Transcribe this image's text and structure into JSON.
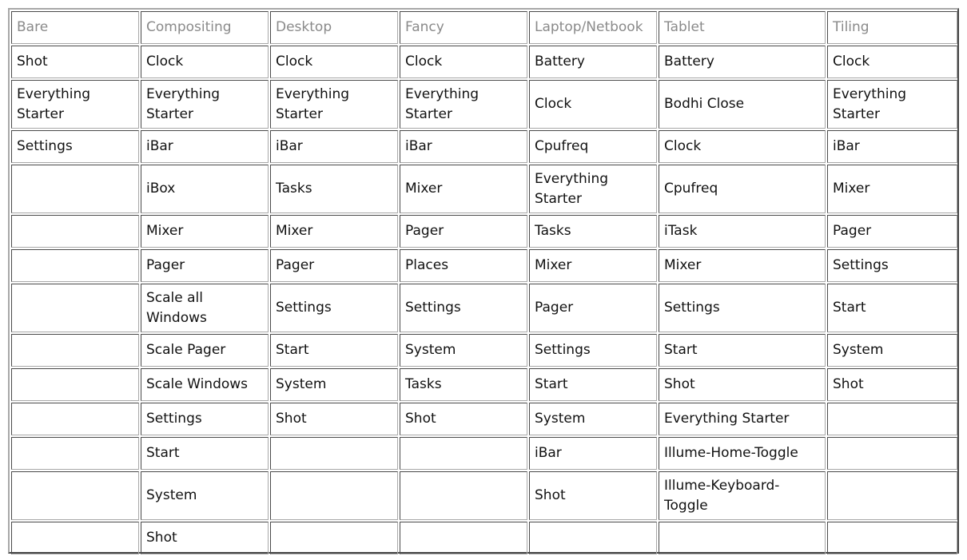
{
  "table": {
    "headers": [
      "Bare",
      "Compositing",
      "Desktop",
      "Fancy",
      "Laptop/Netbook",
      "Tablet",
      "Tiling"
    ],
    "rows": [
      [
        "Shot",
        "Clock",
        "Clock",
        "Clock",
        "Battery",
        "Battery",
        "Clock"
      ],
      [
        "Everything Starter",
        "Everything Starter",
        "Everything Starter",
        "Everything Starter",
        "Clock",
        "Bodhi Close",
        "Everything Starter"
      ],
      [
        "Settings",
        "iBar",
        "iBar",
        "iBar",
        "Cpufreq",
        "Clock",
        "iBar"
      ],
      [
        "",
        "iBox",
        "Tasks",
        "Mixer",
        "Everything Starter",
        "Cpufreq",
        "Mixer"
      ],
      [
        "",
        "Mixer",
        "Mixer",
        "Pager",
        "Tasks",
        "iTask",
        "Pager"
      ],
      [
        "",
        "Pager",
        "Pager",
        "Places",
        "Mixer",
        "Mixer",
        "Settings"
      ],
      [
        "",
        "Scale all Windows",
        "Settings",
        "Settings",
        "Pager",
        "Settings",
        "Start"
      ],
      [
        "",
        "Scale Pager",
        "Start",
        "System",
        "Settings",
        "Start",
        "System"
      ],
      [
        "",
        "Scale Windows",
        "System",
        "Tasks",
        "Start",
        "Shot",
        "Shot"
      ],
      [
        "",
        "Settings",
        "Shot",
        "Shot",
        "System",
        "Everything Starter",
        ""
      ],
      [
        "",
        "Start",
        "",
        "",
        "iBar",
        "Illume-Home-Toggle",
        ""
      ],
      [
        "",
        "System",
        "",
        "",
        "Shot",
        "Illume-Keyboard-Toggle",
        ""
      ],
      [
        "",
        "Shot",
        "",
        "",
        "",
        "",
        ""
      ]
    ]
  }
}
